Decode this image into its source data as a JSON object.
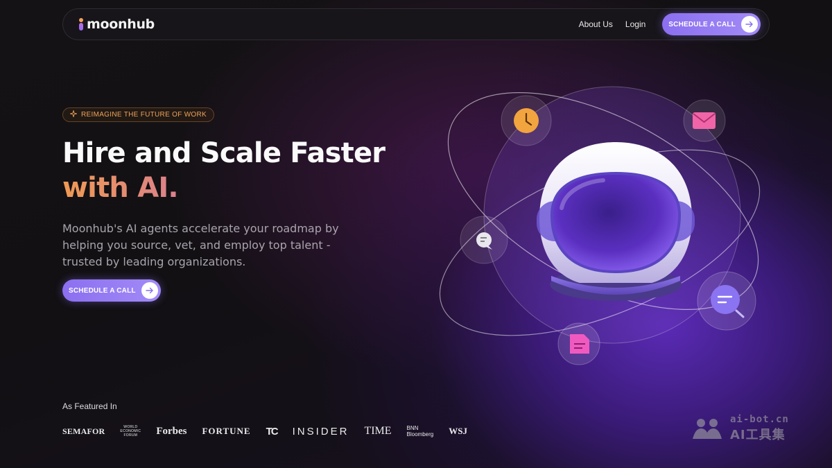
{
  "nav": {
    "logo_text": "moonhub",
    "links": [
      "About Us",
      "Login"
    ],
    "cta_label": "SCHEDULE A CALL"
  },
  "hero": {
    "badge": "REIMAGINE THE FUTURE OF WORK",
    "title_line1": "Hire and Scale Faster",
    "title_line2": "with AI.",
    "subtitle": "Moonhub's AI agents accelerate your roadmap by helping you source, vet, and employ top talent - trusted by leading organizations.",
    "cta_label": "SCHEDULE A CALL"
  },
  "featured": {
    "label": "As Featured In",
    "logos": {
      "semafor": "SEMAFOR",
      "wef_1": "WORLD",
      "wef_2": "ECONOMIC",
      "wef_3": "FORUM",
      "forbes": "Forbes",
      "fortune": "FORTUNE",
      "techcrunch": "TC",
      "insider": "INSIDER",
      "time": "TIME",
      "bnn_1": "BNN",
      "bnn_2": "Bloomberg",
      "wsj": "WSJ"
    }
  },
  "watermark": {
    "line1": "ai-bot.cn",
    "line2": "AI工具集"
  },
  "colors": {
    "accent_purple": "#8b6ff0",
    "accent_orange": "#f0a35a",
    "background": "#141214"
  },
  "icons": [
    "clock-icon",
    "mail-icon",
    "chat-icon",
    "search-icon",
    "document-icon",
    "arrow-right-icon",
    "sparkle-icon"
  ]
}
